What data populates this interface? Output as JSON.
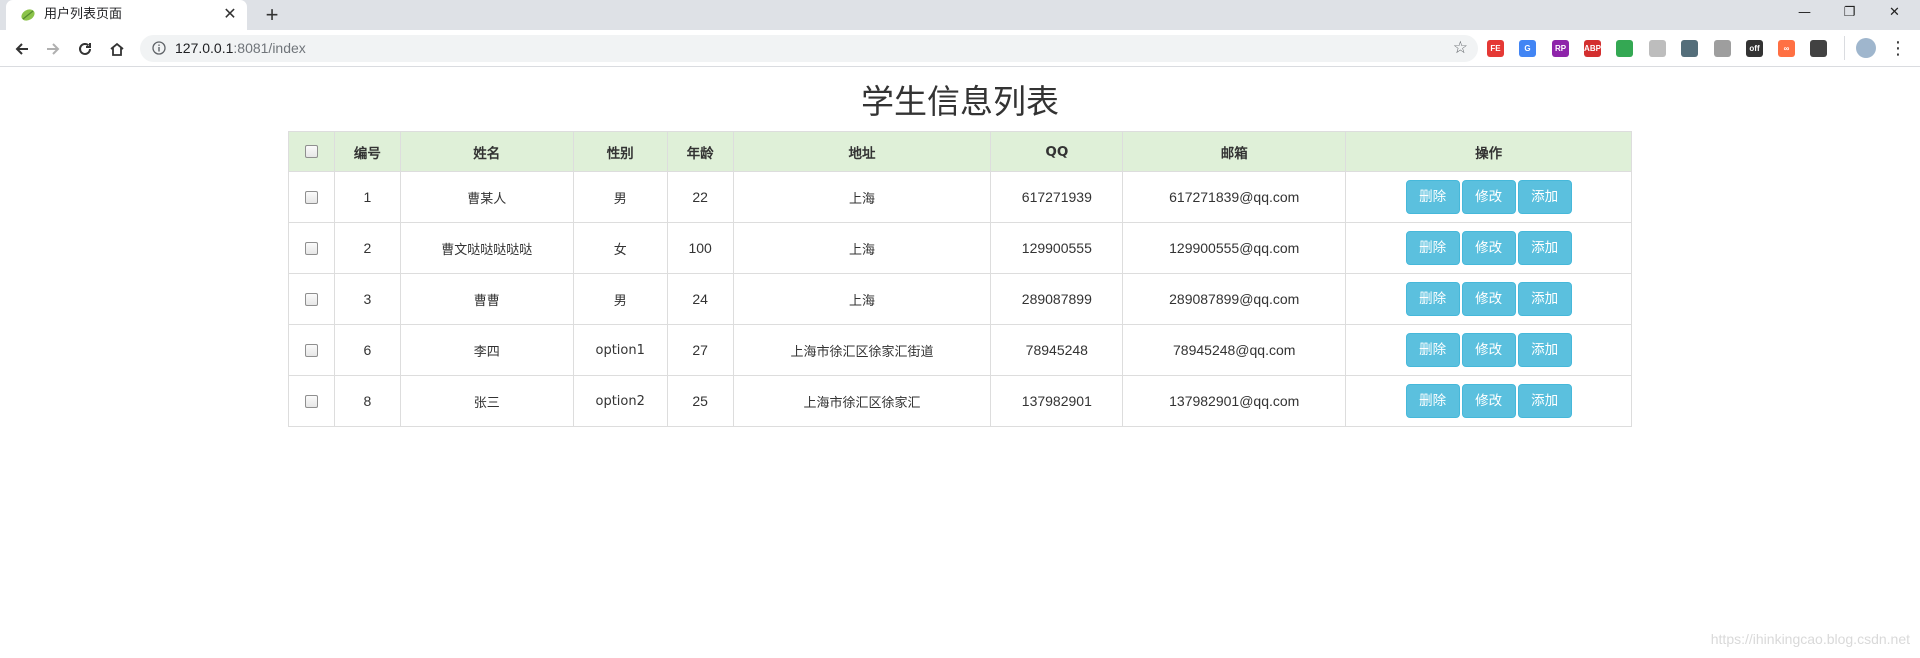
{
  "browser": {
    "tab_title": "用户列表页面",
    "tab_close": "✕",
    "new_tab": "+",
    "window_controls": {
      "minimize": "—",
      "restore": "❐",
      "close": "✕"
    },
    "url_host": "127.0.0.1",
    "url_rest": ":8081/index",
    "star": "☆",
    "extensions": [
      {
        "name": "fe-icon",
        "label": "FE",
        "color": "#e53935"
      },
      {
        "name": "translate-icon",
        "label": "G",
        "color": "#4285f4"
      },
      {
        "name": "rp-icon",
        "label": "RP",
        "color": "#8e24aa"
      },
      {
        "name": "abp-icon",
        "label": "ABP",
        "color": "#d32f2f"
      },
      {
        "name": "chrome-ext-icon",
        "label": "",
        "color": "#34a853"
      },
      {
        "name": "grey-ext-icon",
        "label": "",
        "color": "#bdbdbd"
      },
      {
        "name": "dash-ext-icon",
        "label": "",
        "color": "#546e7a"
      },
      {
        "name": "box-ext-icon",
        "label": "",
        "color": "#9e9e9e"
      },
      {
        "name": "list-off-icon",
        "label": "off",
        "color": "#333333"
      },
      {
        "name": "infinity-icon",
        "label": "∞",
        "color": "#ff7043"
      },
      {
        "name": "sync-icon",
        "label": "",
        "color": "#424242"
      }
    ],
    "menu": "⋮"
  },
  "page": {
    "title": "学生信息列表",
    "watermark": "https://ihinkingcao.blog.csdn.net"
  },
  "table": {
    "headers": [
      "编号",
      "姓名",
      "性别",
      "年龄",
      "地址",
      "QQ",
      "邮箱",
      "操作"
    ],
    "rows": [
      {
        "id": "1",
        "name": "曹某人",
        "gender": "男",
        "age": "22",
        "address": "上海",
        "qq": "617271939",
        "email": "617271839@qq.com"
      },
      {
        "id": "2",
        "name": "曹文哒哒哒哒哒",
        "gender": "女",
        "age": "100",
        "address": "上海",
        "qq": "129900555",
        "email": "129900555@qq.com"
      },
      {
        "id": "3",
        "name": "曹曹",
        "gender": "男",
        "age": "24",
        "address": "上海",
        "qq": "289087899",
        "email": "289087899@qq.com"
      },
      {
        "id": "6",
        "name": "李四",
        "gender": "option1",
        "age": "27",
        "address": "上海市徐汇区徐家汇街道",
        "qq": "78945248",
        "email": "78945248@qq.com"
      },
      {
        "id": "8",
        "name": "张三",
        "gender": "option2",
        "age": "25",
        "address": "上海市徐汇区徐家汇",
        "qq": "137982901",
        "email": "137982901@qq.com"
      }
    ],
    "actions": {
      "delete": "删除",
      "edit": "修改",
      "add": "添加"
    },
    "action_color": "#5bc0de",
    "header_bg": "#dff0d8"
  }
}
